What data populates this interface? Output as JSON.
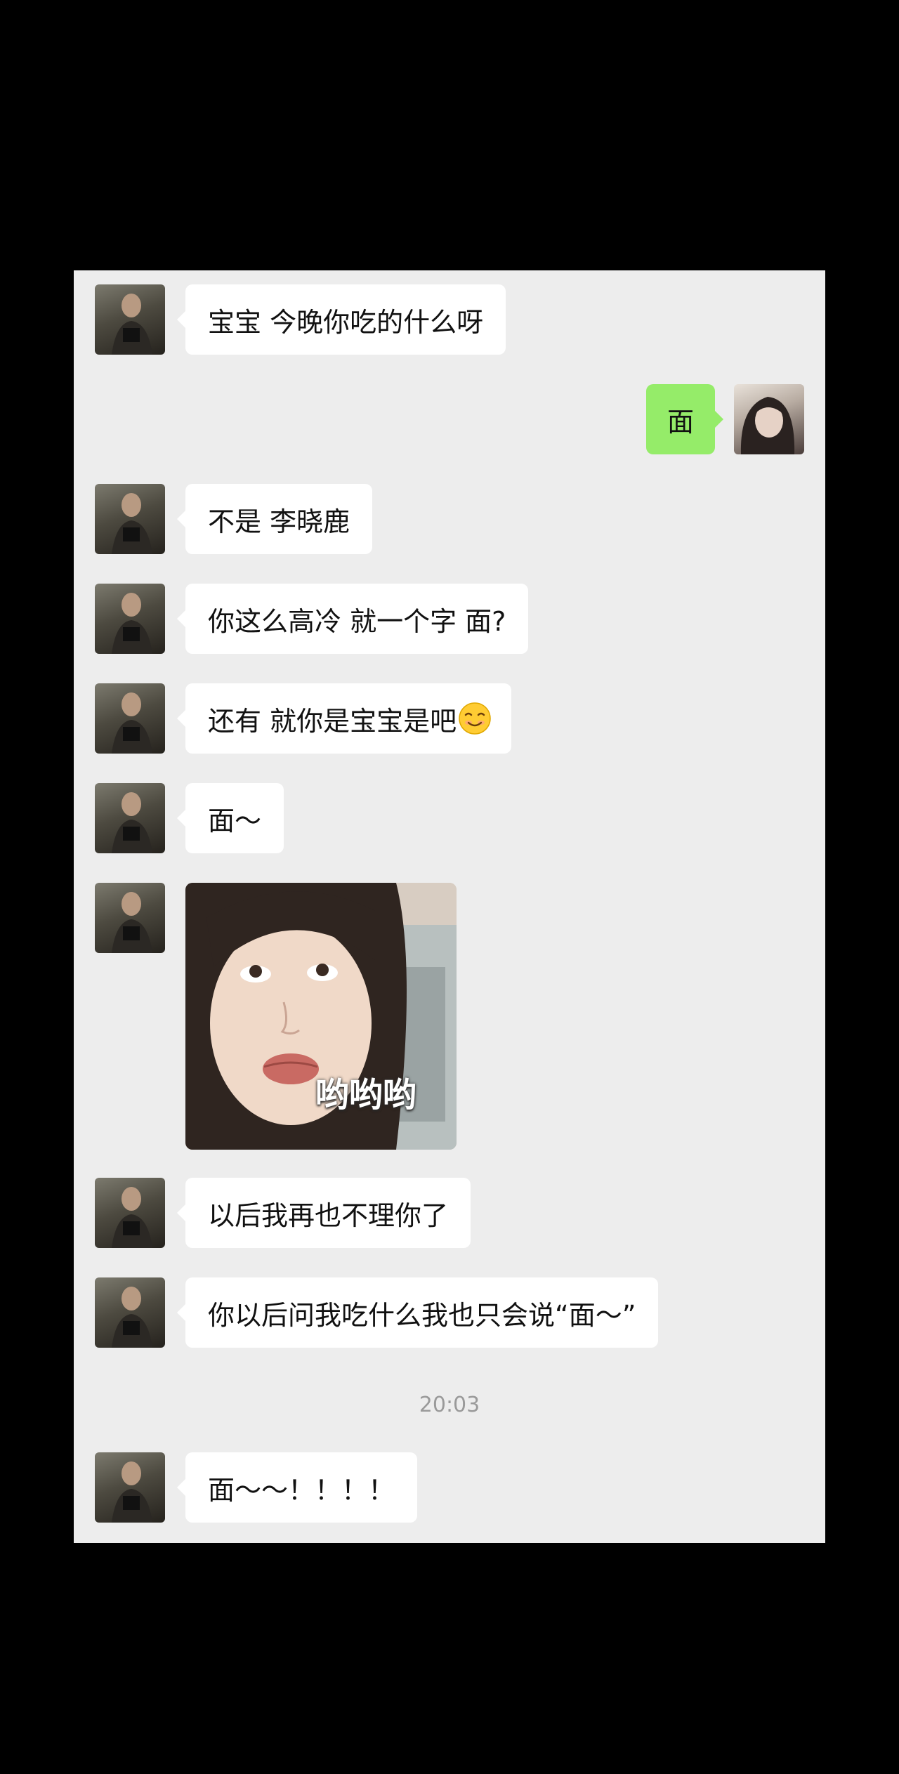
{
  "chat": {
    "messages": [
      {
        "text": "宝宝 今晚你吃的什么呀"
      },
      {
        "text": "面"
      },
      {
        "text": "不是 李晓鹿"
      },
      {
        "text": "你这么高冷 就一个字 面?"
      },
      {
        "text": "还有 就你是宝宝是吧",
        "emoji": "smiling-face-emoji"
      },
      {
        "text": "面～"
      },
      {
        "sticker_caption": "哟哟哟"
      },
      {
        "text": "以后我再也不理你了"
      },
      {
        "text": "你以后问我吃什么我也只会说“面～”"
      },
      {
        "text": "面～～！！！！"
      }
    ],
    "timestamp": "20:03"
  },
  "colors": {
    "background": "#000000",
    "chat_background": "#ededed",
    "incoming_bubble": "#ffffff",
    "outgoing_bubble": "#95ec69",
    "timestamp_text": "#9a9a9a"
  }
}
